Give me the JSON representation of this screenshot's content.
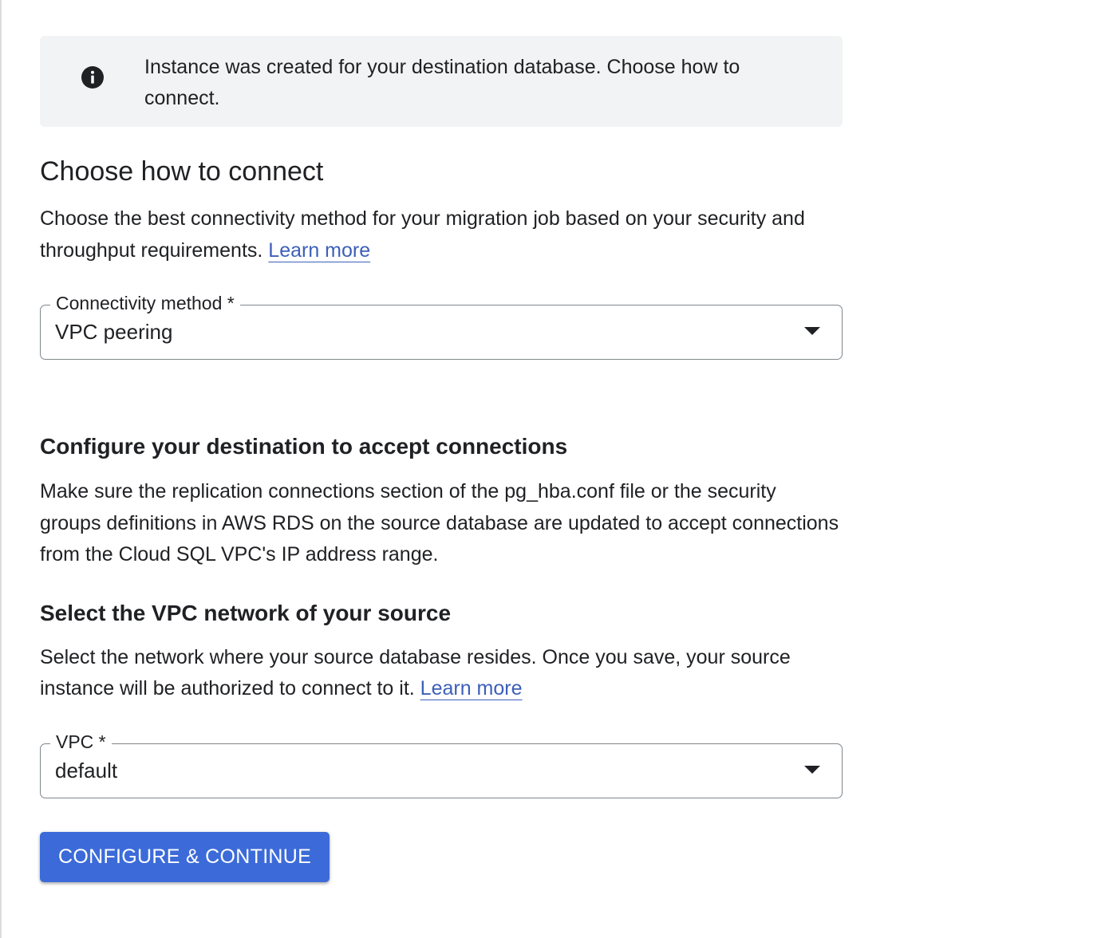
{
  "banner": {
    "icon": "info-icon",
    "message": "Instance was created for your destination database. Choose how to connect."
  },
  "connect_section": {
    "title": "Choose how to connect",
    "description": "Choose the best connectivity method for your migration job based on your security and throughput requirements.",
    "learn_more": "Learn more",
    "field": {
      "label": "Connectivity method *",
      "value": "VPC peering"
    }
  },
  "destination_section": {
    "title": "Configure your destination to accept connections",
    "description": "Make sure the replication connections section of the pg_hba.conf file or the security groups definitions in AWS RDS on the source database are updated to accept connections from the Cloud SQL VPC's IP address range."
  },
  "vpc_section": {
    "title": "Select the VPC network of your source",
    "description": "Select the network where your source database resides. Once you save, your source instance will be authorized to connect to it.",
    "learn_more": "Learn more",
    "field": {
      "label": "VPC *",
      "value": "default"
    }
  },
  "actions": {
    "primary_label": "CONFIGURE & CONTINUE"
  },
  "colors": {
    "primary": "#3c6bd9",
    "link": "#3c5fb8",
    "banner_background": "#f1f3f4",
    "text": "#202124"
  }
}
